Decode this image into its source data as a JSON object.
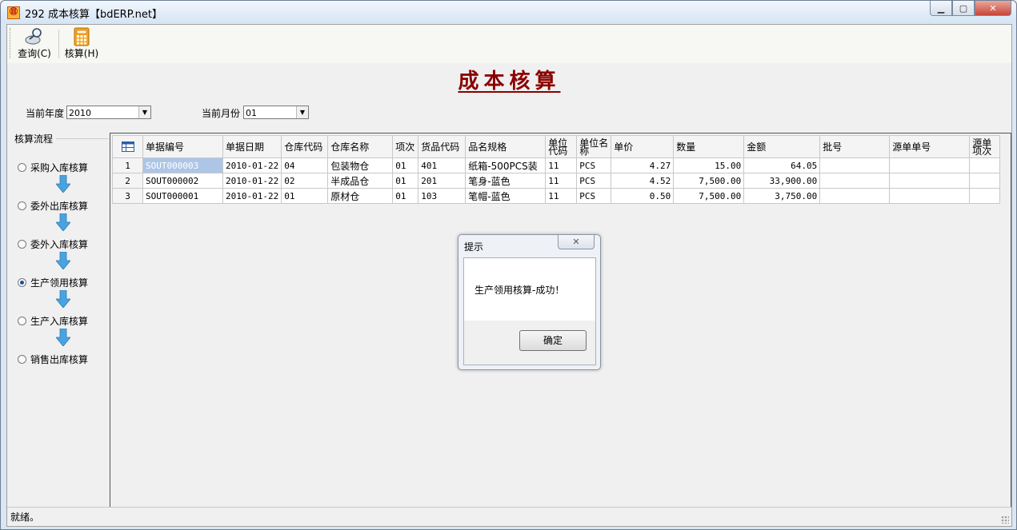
{
  "window": {
    "title": "292 成本核算【bdERP.net】"
  },
  "toolbar": {
    "query_label": "查询(C)",
    "calc_label": "核算(H)"
  },
  "page_title": "成本核算",
  "filters": {
    "year_label": "当前年度",
    "year_value": "2010",
    "month_label": "当前月份",
    "month_value": "01"
  },
  "sidebar": {
    "title": "核算流程",
    "steps": [
      {
        "label": "采购入库核算",
        "selected": false
      },
      {
        "label": "委外出库核算",
        "selected": false
      },
      {
        "label": "委外入库核算",
        "selected": false
      },
      {
        "label": "生产领用核算",
        "selected": true
      },
      {
        "label": "生产入库核算",
        "selected": false
      },
      {
        "label": "销售出库核算",
        "selected": false
      }
    ]
  },
  "grid": {
    "columns": [
      "单据编号",
      "单据日期",
      "仓库代码",
      "仓库名称",
      "项次",
      "货品代码",
      "品名规格",
      "单位代码",
      "单位名称",
      "单价",
      "数量",
      "金额",
      "批号",
      "源单单号",
      "源单项次"
    ],
    "rows": [
      {
        "rn": "1",
        "cells": [
          "SOUT000003",
          "2010-01-22",
          "04",
          "包装物仓",
          "01",
          "401",
          "纸箱-500PCS装",
          "11",
          "PCS",
          "4.27",
          "15.00",
          "64.05",
          "",
          "",
          ""
        ]
      },
      {
        "rn": "2",
        "cells": [
          "SOUT000002",
          "2010-01-22",
          "02",
          "半成品仓",
          "01",
          "201",
          "笔身-蓝色",
          "11",
          "PCS",
          "4.52",
          "7,500.00",
          "33,900.00",
          "",
          "",
          ""
        ]
      },
      {
        "rn": "3",
        "cells": [
          "SOUT000001",
          "2010-01-22",
          "01",
          "原材仓",
          "01",
          "103",
          "笔帽-蓝色",
          "11",
          "PCS",
          "0.50",
          "7,500.00",
          "3,750.00",
          "",
          "",
          ""
        ]
      }
    ]
  },
  "status": {
    "text": "就绪。"
  },
  "dialog": {
    "title": "提示",
    "message": "生产领用核算-成功！",
    "ok_label": "确定"
  }
}
